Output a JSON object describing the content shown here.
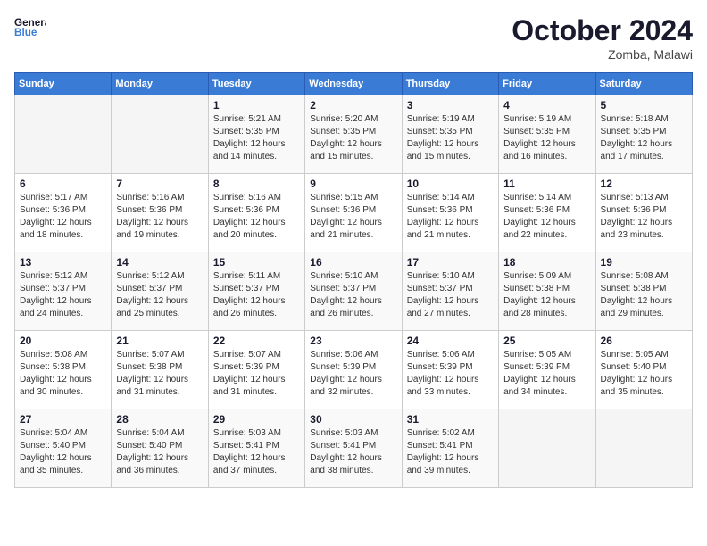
{
  "header": {
    "logo_line1": "General",
    "logo_line2": "Blue",
    "month_year": "October 2024",
    "location": "Zomba, Malawi"
  },
  "weekdays": [
    "Sunday",
    "Monday",
    "Tuesday",
    "Wednesday",
    "Thursday",
    "Friday",
    "Saturday"
  ],
  "weeks": [
    [
      {
        "day": "",
        "sunrise": "",
        "sunset": "",
        "daylight": ""
      },
      {
        "day": "",
        "sunrise": "",
        "sunset": "",
        "daylight": ""
      },
      {
        "day": "1",
        "sunrise": "Sunrise: 5:21 AM",
        "sunset": "Sunset: 5:35 PM",
        "daylight": "Daylight: 12 hours and 14 minutes."
      },
      {
        "day": "2",
        "sunrise": "Sunrise: 5:20 AM",
        "sunset": "Sunset: 5:35 PM",
        "daylight": "Daylight: 12 hours and 15 minutes."
      },
      {
        "day": "3",
        "sunrise": "Sunrise: 5:19 AM",
        "sunset": "Sunset: 5:35 PM",
        "daylight": "Daylight: 12 hours and 15 minutes."
      },
      {
        "day": "4",
        "sunrise": "Sunrise: 5:19 AM",
        "sunset": "Sunset: 5:35 PM",
        "daylight": "Daylight: 12 hours and 16 minutes."
      },
      {
        "day": "5",
        "sunrise": "Sunrise: 5:18 AM",
        "sunset": "Sunset: 5:35 PM",
        "daylight": "Daylight: 12 hours and 17 minutes."
      }
    ],
    [
      {
        "day": "6",
        "sunrise": "Sunrise: 5:17 AM",
        "sunset": "Sunset: 5:36 PM",
        "daylight": "Daylight: 12 hours and 18 minutes."
      },
      {
        "day": "7",
        "sunrise": "Sunrise: 5:16 AM",
        "sunset": "Sunset: 5:36 PM",
        "daylight": "Daylight: 12 hours and 19 minutes."
      },
      {
        "day": "8",
        "sunrise": "Sunrise: 5:16 AM",
        "sunset": "Sunset: 5:36 PM",
        "daylight": "Daylight: 12 hours and 20 minutes."
      },
      {
        "day": "9",
        "sunrise": "Sunrise: 5:15 AM",
        "sunset": "Sunset: 5:36 PM",
        "daylight": "Daylight: 12 hours and 21 minutes."
      },
      {
        "day": "10",
        "sunrise": "Sunrise: 5:14 AM",
        "sunset": "Sunset: 5:36 PM",
        "daylight": "Daylight: 12 hours and 21 minutes."
      },
      {
        "day": "11",
        "sunrise": "Sunrise: 5:14 AM",
        "sunset": "Sunset: 5:36 PM",
        "daylight": "Daylight: 12 hours and 22 minutes."
      },
      {
        "day": "12",
        "sunrise": "Sunrise: 5:13 AM",
        "sunset": "Sunset: 5:36 PM",
        "daylight": "Daylight: 12 hours and 23 minutes."
      }
    ],
    [
      {
        "day": "13",
        "sunrise": "Sunrise: 5:12 AM",
        "sunset": "Sunset: 5:37 PM",
        "daylight": "Daylight: 12 hours and 24 minutes."
      },
      {
        "day": "14",
        "sunrise": "Sunrise: 5:12 AM",
        "sunset": "Sunset: 5:37 PM",
        "daylight": "Daylight: 12 hours and 25 minutes."
      },
      {
        "day": "15",
        "sunrise": "Sunrise: 5:11 AM",
        "sunset": "Sunset: 5:37 PM",
        "daylight": "Daylight: 12 hours and 26 minutes."
      },
      {
        "day": "16",
        "sunrise": "Sunrise: 5:10 AM",
        "sunset": "Sunset: 5:37 PM",
        "daylight": "Daylight: 12 hours and 26 minutes."
      },
      {
        "day": "17",
        "sunrise": "Sunrise: 5:10 AM",
        "sunset": "Sunset: 5:37 PM",
        "daylight": "Daylight: 12 hours and 27 minutes."
      },
      {
        "day": "18",
        "sunrise": "Sunrise: 5:09 AM",
        "sunset": "Sunset: 5:38 PM",
        "daylight": "Daylight: 12 hours and 28 minutes."
      },
      {
        "day": "19",
        "sunrise": "Sunrise: 5:08 AM",
        "sunset": "Sunset: 5:38 PM",
        "daylight": "Daylight: 12 hours and 29 minutes."
      }
    ],
    [
      {
        "day": "20",
        "sunrise": "Sunrise: 5:08 AM",
        "sunset": "Sunset: 5:38 PM",
        "daylight": "Daylight: 12 hours and 30 minutes."
      },
      {
        "day": "21",
        "sunrise": "Sunrise: 5:07 AM",
        "sunset": "Sunset: 5:38 PM",
        "daylight": "Daylight: 12 hours and 31 minutes."
      },
      {
        "day": "22",
        "sunrise": "Sunrise: 5:07 AM",
        "sunset": "Sunset: 5:39 PM",
        "daylight": "Daylight: 12 hours and 31 minutes."
      },
      {
        "day": "23",
        "sunrise": "Sunrise: 5:06 AM",
        "sunset": "Sunset: 5:39 PM",
        "daylight": "Daylight: 12 hours and 32 minutes."
      },
      {
        "day": "24",
        "sunrise": "Sunrise: 5:06 AM",
        "sunset": "Sunset: 5:39 PM",
        "daylight": "Daylight: 12 hours and 33 minutes."
      },
      {
        "day": "25",
        "sunrise": "Sunrise: 5:05 AM",
        "sunset": "Sunset: 5:39 PM",
        "daylight": "Daylight: 12 hours and 34 minutes."
      },
      {
        "day": "26",
        "sunrise": "Sunrise: 5:05 AM",
        "sunset": "Sunset: 5:40 PM",
        "daylight": "Daylight: 12 hours and 35 minutes."
      }
    ],
    [
      {
        "day": "27",
        "sunrise": "Sunrise: 5:04 AM",
        "sunset": "Sunset: 5:40 PM",
        "daylight": "Daylight: 12 hours and 35 minutes."
      },
      {
        "day": "28",
        "sunrise": "Sunrise: 5:04 AM",
        "sunset": "Sunset: 5:40 PM",
        "daylight": "Daylight: 12 hours and 36 minutes."
      },
      {
        "day": "29",
        "sunrise": "Sunrise: 5:03 AM",
        "sunset": "Sunset: 5:41 PM",
        "daylight": "Daylight: 12 hours and 37 minutes."
      },
      {
        "day": "30",
        "sunrise": "Sunrise: 5:03 AM",
        "sunset": "Sunset: 5:41 PM",
        "daylight": "Daylight: 12 hours and 38 minutes."
      },
      {
        "day": "31",
        "sunrise": "Sunrise: 5:02 AM",
        "sunset": "Sunset: 5:41 PM",
        "daylight": "Daylight: 12 hours and 39 minutes."
      },
      {
        "day": "",
        "sunrise": "",
        "sunset": "",
        "daylight": ""
      },
      {
        "day": "",
        "sunrise": "",
        "sunset": "",
        "daylight": ""
      }
    ]
  ]
}
